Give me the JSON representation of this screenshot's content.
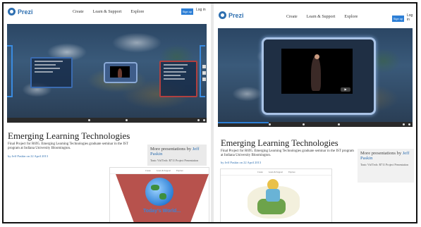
{
  "brand": {
    "name": "Prezi"
  },
  "nav": [
    "Create",
    "Learn & Support",
    "Explore"
  ],
  "header": {
    "signup": "Sign up",
    "login": "Log in"
  },
  "presentation": {
    "title": "Emerging Learning Technologies",
    "description": "Final Project for R695. Emerging Learning Technologies graduate seminar in the IST program at Indiana University Bloomington.",
    "author_line": "by Jeff Paskin on 22 April 2013"
  },
  "more": {
    "label": "More presentations by",
    "author": "Jeff Paskin",
    "item": "Tonic Vid Tech: R711 Project Presentation"
  },
  "thumbnails": {
    "left_caption": "Today's World..."
  },
  "colors": {
    "accent": "#2d7fd6",
    "frame_border": "#3b6bb0",
    "video_glow": "#a9c3e6"
  },
  "icons": [
    "prezi-logo-icon",
    "fullscreen-icon",
    "share-icon",
    "zoom-in-icon",
    "zoom-out-icon",
    "home-icon",
    "prev-icon",
    "next-icon",
    "youtube-icon"
  ]
}
